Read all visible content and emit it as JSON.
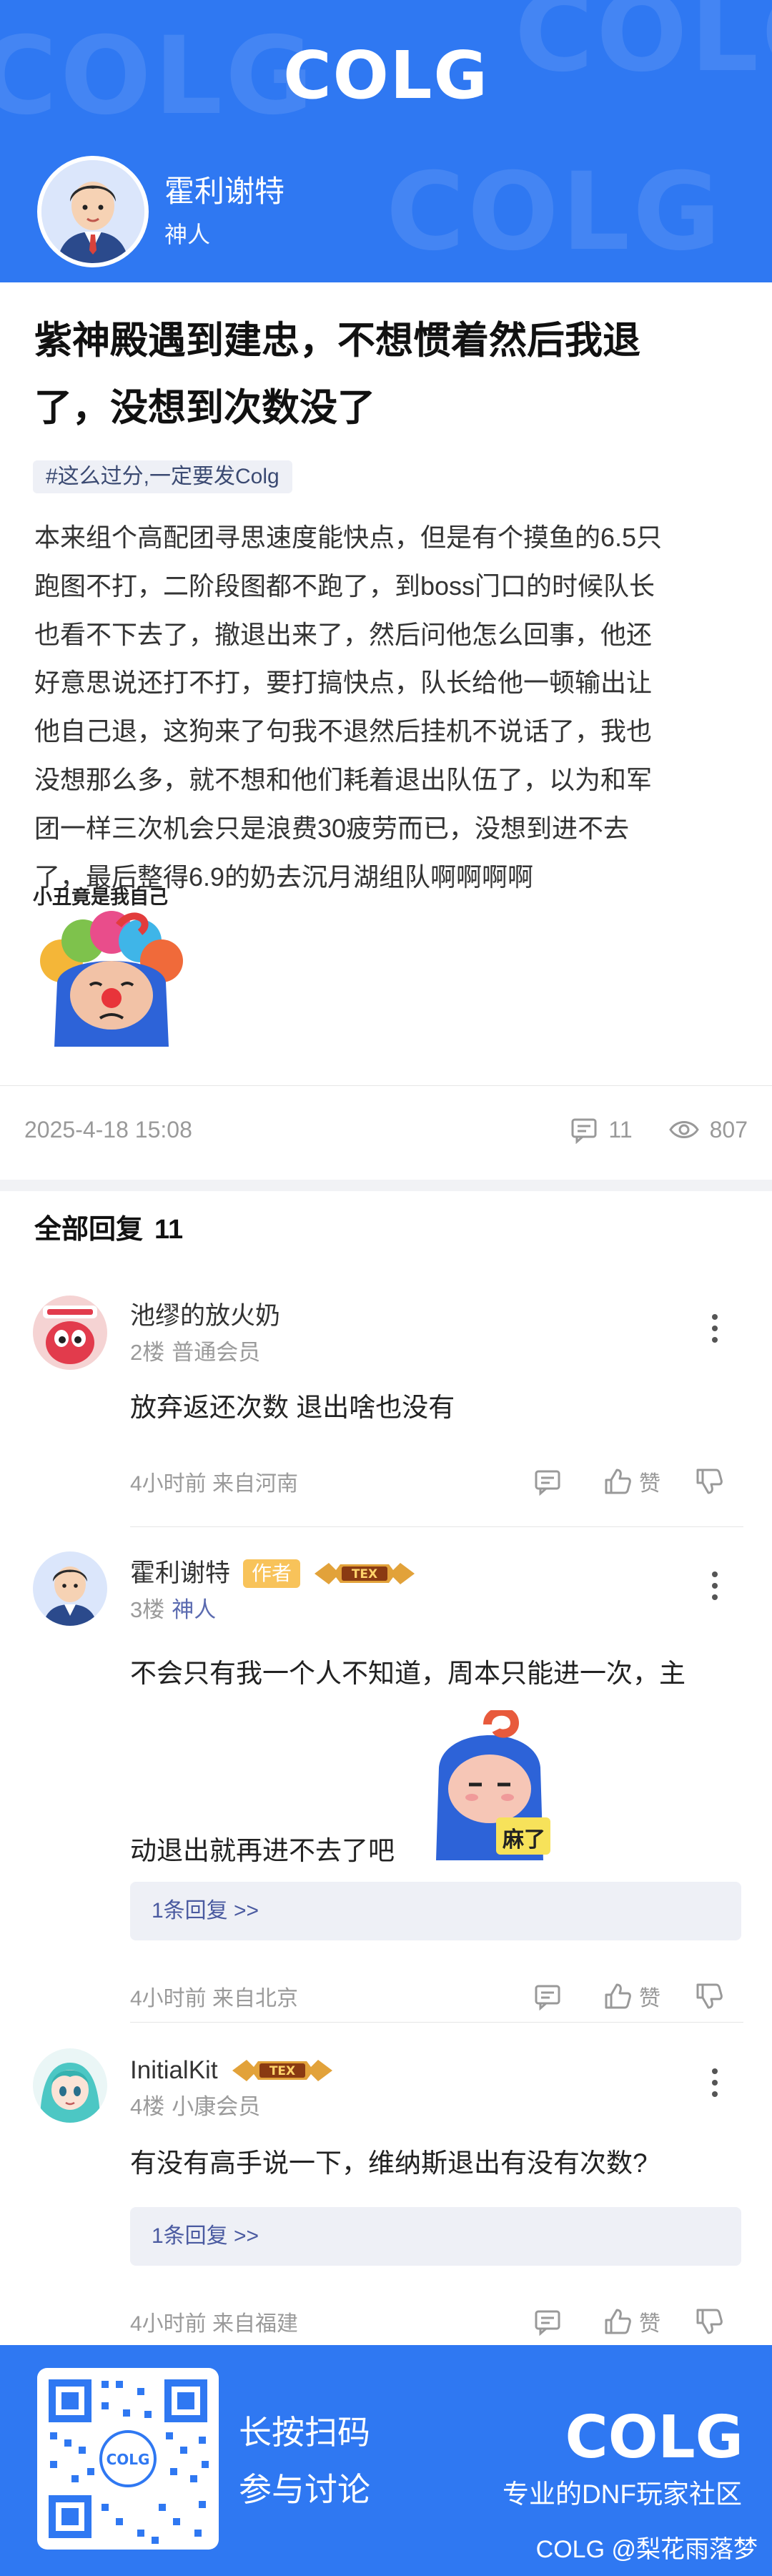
{
  "brand": {
    "logo_text": "COLG",
    "primary_color": "#2f78f2"
  },
  "author": {
    "name": "霍利谢特",
    "rank": "神人"
  },
  "post": {
    "title_line1": "紫神殿遇到建忠，不想惯着然后我退",
    "title_line2": "了，没想到次数没了",
    "tag": "#这么过分,一定要发Colg",
    "body_lines": [
      "本来组个高配团寻思速度能快点，但是有个摸鱼的6.5只",
      "跑图不打，二阶段图都不跑了，到boss门口的时候队长",
      "也看不下去了，撤退出来了，然后问他怎么回事，他还",
      "好意思说还打不打，要打搞快点，队长给他一顿输出让",
      "他自己退，这狗来了句我不退然后挂机不说话了，我也",
      "没想那么多，就不想和他们耗着退出队伍了，以为和军",
      "团一样三次机会只是浪费30疲劳而已，没想到进不去",
      "了，最后整得6.9的奶去沉月湖组队啊啊啊啊"
    ],
    "sticker_caption": "小丑竟是我自己",
    "date": "2025-4-18 15:08",
    "comment_count": "11",
    "view_count": "807"
  },
  "replies_section": {
    "title": "全部回复",
    "count": "11"
  },
  "replies": [
    {
      "name": "池缪的放火奶",
      "floor": "2楼",
      "rank": "普通会员",
      "text": "放弃返还次数 退出啥也没有",
      "meta": "4小时前 来自河南",
      "like_label": "赞"
    },
    {
      "name": "霍利谢特",
      "author_badge": "作者",
      "level_badge": "TEX",
      "floor": "3楼",
      "rank": "神人",
      "text_line1": "不会只有我一个人不知道，周本只能进一次，主",
      "text_line2": "动退出就再进不去了吧",
      "sticker_caption": "麻了",
      "sub_reply": "1条回复 >>",
      "meta": "4小时前 来自北京",
      "like_label": "赞"
    },
    {
      "name": "InitialKit",
      "level_badge": "TEX",
      "floor": "4楼",
      "rank": "小康会员",
      "text": "有没有高手说一下，维纳斯退出有没有次数?",
      "sub_reply": "1条回复 >>",
      "meta": "4小时前 来自福建",
      "like_label": "赞"
    }
  ],
  "footer": {
    "scan_text": "长按扫码",
    "join_text": "参与讨论",
    "logo_text": "COLG",
    "slogan": "专业的DNF玩家社区",
    "credit": "COLG @梨花雨落梦"
  }
}
